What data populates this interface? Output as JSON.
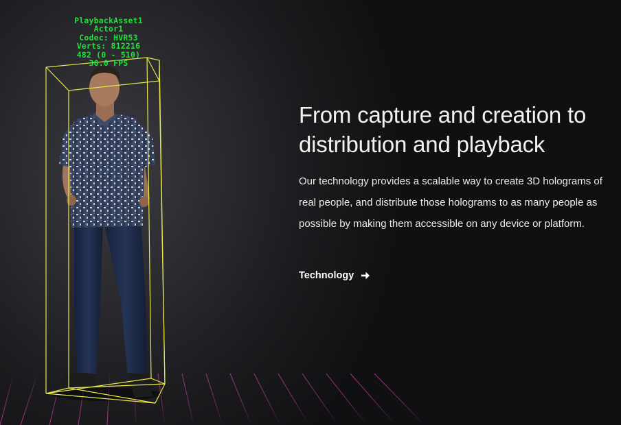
{
  "hud": {
    "lines": [
      "PlaybackAsset1",
      "Actor1",
      "Codec: HVR53",
      "Verts: 812216",
      "482 (0 - 510)",
      "30.0 FPS"
    ]
  },
  "content": {
    "headline_line1": "From capture and creation to",
    "headline_line2": "distribution and playback",
    "body": "Our technology provides a scalable way to create 3D holograms of real people, and distribute those holograms to as many people as possible by making them accessible on any device or platform.",
    "link_label": "Technology",
    "link_icon": "arrow-right-icon"
  },
  "colors": {
    "hud_text": "#22e03a",
    "bounding_box": "#e8e84a",
    "grid": "#c23b9a",
    "background": "#111113",
    "text": "#f2f2f2"
  }
}
